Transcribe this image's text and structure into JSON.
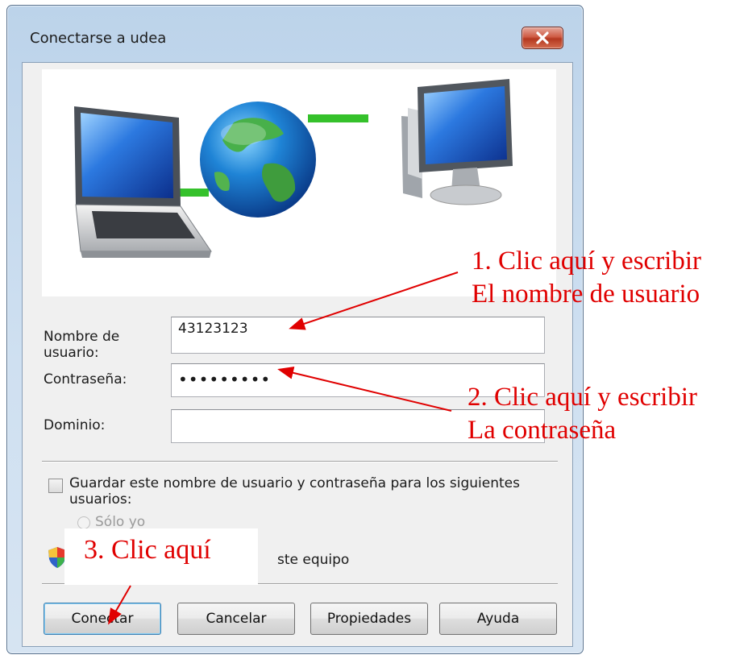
{
  "window": {
    "title": "Conectarse a udea"
  },
  "form": {
    "username_label": "Nombre de usuario:",
    "username_value": "43123123",
    "password_label": "Contraseña:",
    "password_value": "•••••••••",
    "domain_label": "Dominio:",
    "domain_value": ""
  },
  "save_options": {
    "save_label": "Guardar este nombre de usuario y contraseña para los siguientes usuarios:",
    "only_me_label": "Sólo yo",
    "shield_text_visible": "ste equipo"
  },
  "buttons": {
    "connect": "Conectar",
    "cancel": "Cancelar",
    "properties": "Propiedades",
    "help": "Ayuda"
  },
  "annotations": {
    "step1_line1": "1.  Clic aquí y escribir",
    "step1_line2": "El nombre de usuario",
    "step2_line1": "2.  Clic aquí y escribir",
    "step2_line2": "La contraseña",
    "step3": "3. Clic aquí"
  },
  "colors": {
    "annotation": "#e00000",
    "title_bar": "#c6daee",
    "close_button": "#c7452e"
  }
}
